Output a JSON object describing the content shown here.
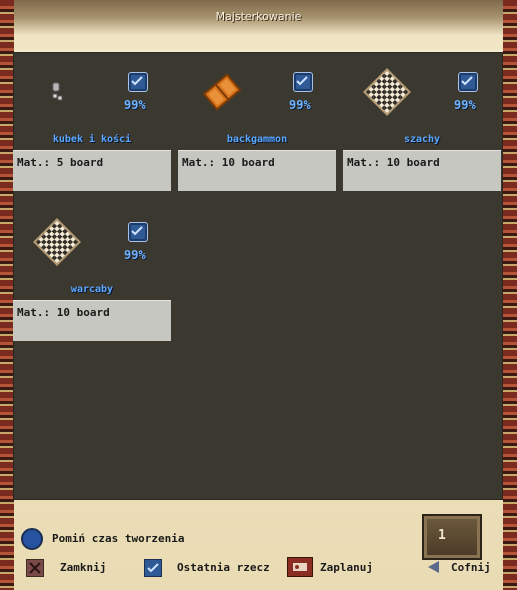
{
  "window": {
    "title": "Majsterkowanie"
  },
  "items": [
    {
      "name": "kubek i kości",
      "mat_label": "Mat.:",
      "mat_value": "5 board",
      "percent": "99%",
      "icon": "dice-cup-icon"
    },
    {
      "name": "backgammon",
      "mat_label": "Mat.:",
      "mat_value": "10 board",
      "percent": "99%",
      "icon": "backgammon-board-icon"
    },
    {
      "name": "szachy",
      "mat_label": "Mat.:",
      "mat_value": "10 board",
      "percent": "99%",
      "icon": "chess-board-icon"
    },
    {
      "name": "warcaby",
      "mat_label": "Mat.:",
      "mat_value": "10 board",
      "percent": "99%",
      "icon": "checkers-board-icon"
    }
  ],
  "footer": {
    "skip_time_label": "Pomiń czas tworzenia",
    "close_label": "Zamknij",
    "last_item_label": "Ostatnia rzecz",
    "plan_label": "Zaplanuj",
    "back_label": "Cofnij",
    "quantity": "1"
  },
  "colors": {
    "accent_text": "#5ba8ff",
    "panel_bg": "#3b3830",
    "mat_bg": "#c6c7c0"
  }
}
